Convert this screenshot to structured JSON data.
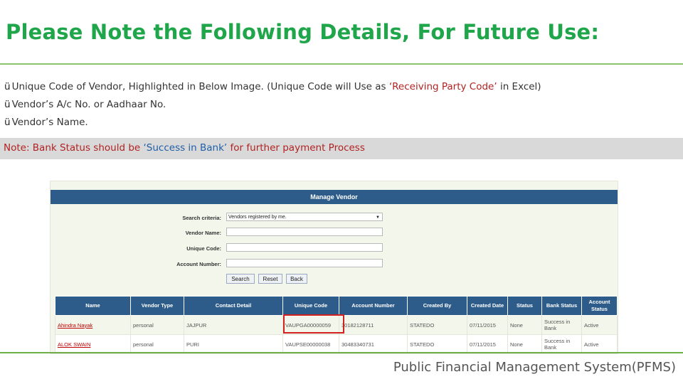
{
  "title": "Please Note the Following Details, For Future Use:",
  "bullets": {
    "check": "ü",
    "b1_pre": "Unique Code of Vendor, Highlighted in Below Image. (Unique Code will Use as ",
    "b1_red": "‘Receiving Party Code’",
    "b1_post": " in Excel)",
    "b2": "Vendor’s A/c No. or Aadhaar No.",
    "b3": "Vendor’s Name."
  },
  "note": {
    "pre": "Note: Bank Status should be ",
    "blue": "‘Success in Bank’",
    "post": " for further payment Process"
  },
  "screenshot": {
    "header": "Manage Vendor",
    "fields": {
      "search_label": "Search criteria:",
      "search_value": "Vendors registered by me.",
      "vendor_name_label": "Vendor Name:",
      "vendor_name_value": "",
      "unique_code_label": "Unique Code:",
      "unique_code_value": "",
      "account_number_label": "Account Number:",
      "account_number_value": ""
    },
    "buttons": {
      "search": "Search",
      "reset": "Reset",
      "back": "Back"
    },
    "columns": [
      "Name",
      "Vendor Type",
      "Contact Detail",
      "Unique Code",
      "Account Number",
      "Created By",
      "Created Date",
      "Status",
      "Bank Status",
      "Account Status"
    ],
    "rows": [
      [
        "Ahindra Nayak",
        "personal",
        "JAJPUR",
        "VAUPGA00000059",
        "30182128711",
        "STATEDO",
        "07/11/2015",
        "None",
        "Success in Bank",
        "Active"
      ],
      [
        "ALOK SWAIN",
        "personal",
        "PURI",
        "VAUPSE00000038",
        "30483340731",
        "STATEDO",
        "07/11/2015",
        "None",
        "Success in Bank",
        "Active"
      ]
    ]
  },
  "footer": "Public Financial Management System(PFMS)",
  "colors": {
    "title_green": "#1fa54a",
    "header_blue": "#2d5b8a",
    "highlight_red": "#d42020"
  }
}
